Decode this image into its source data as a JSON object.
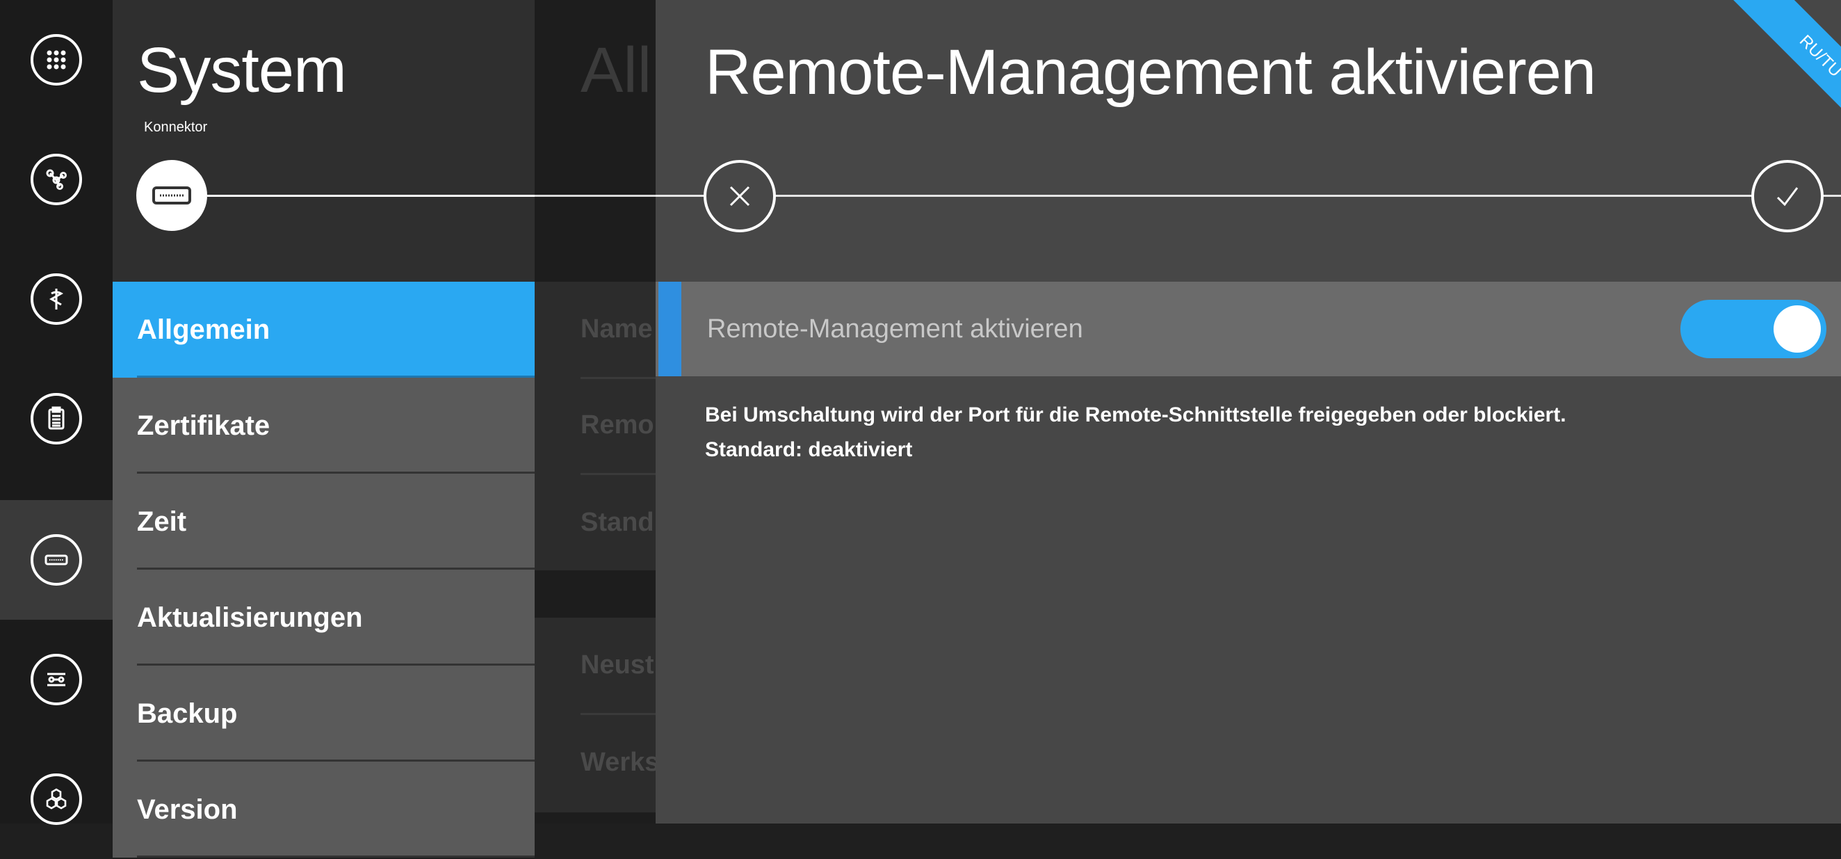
{
  "colors": {
    "accent": "#2aa8f2",
    "setting_accent": "#2f8fe0",
    "rail_bg": "#1b1b1b",
    "panel_bg": "#2f2f2f",
    "detail_bg": "#474747"
  },
  "rail": {
    "items": [
      {
        "icon": "apps-grid-icon",
        "active": false
      },
      {
        "icon": "network-nodes-icon",
        "active": false
      },
      {
        "icon": "medical-staff-icon",
        "active": false
      },
      {
        "icon": "clipboard-icon",
        "active": false
      },
      {
        "icon": "connector-device-icon",
        "active": true
      },
      {
        "icon": "switch-toggle-icon",
        "active": false
      },
      {
        "icon": "hexagon-cluster-icon",
        "active": false
      }
    ]
  },
  "system": {
    "title": "System",
    "subtitle": "Konnektor",
    "node_icon": "connector-device-icon",
    "menu": [
      {
        "label": "Allgemein",
        "active": true
      },
      {
        "label": "Zertifikate",
        "active": false
      },
      {
        "label": "Zeit",
        "active": false
      },
      {
        "label": "Aktualisierungen",
        "active": false
      },
      {
        "label": "Backup",
        "active": false
      },
      {
        "label": "Version",
        "active": false
      }
    ]
  },
  "middle": {
    "title": "All",
    "rows": [
      "Name",
      "Remo",
      "Stand",
      "Neust",
      "Werks"
    ]
  },
  "detail": {
    "title": "Remote-Management aktivieren",
    "cancel_icon": "close-icon",
    "confirm_icon": "checkmark-icon",
    "setting": {
      "label": "Remote-Management aktivieren",
      "enabled": true
    },
    "description": [
      "Bei Umschaltung wird der Port für die Remote-Schnittstelle freigegeben oder blockiert.",
      "Standard: deaktiviert"
    ],
    "ribbon": "RU/TU"
  }
}
